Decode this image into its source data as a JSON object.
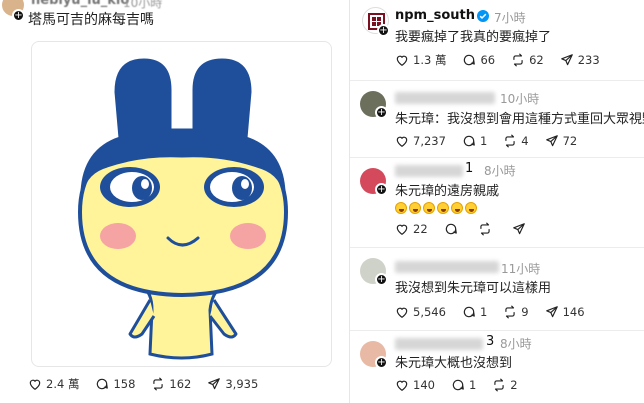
{
  "left_post": {
    "author": "hebiyu_lu_kio",
    "time": "10小時",
    "caption": "塔馬可吉的麻每吉嗎",
    "actions": {
      "likes": "2.4 萬",
      "comments": "158",
      "reposts": "162",
      "shares": "3,935"
    }
  },
  "right_post": {
    "author": "npm_south",
    "time": "7小時",
    "text": "我要瘋掉了我真的要瘋掉了",
    "actions": {
      "likes": "1.3 萬",
      "comments": "66",
      "reposts": "62",
      "shares": "233"
    }
  },
  "replies": [
    {
      "time": "10小時",
      "text": "朱元璋：我沒想到會用這種方式重回大眾視野",
      "actions": {
        "likes": "7,237",
        "comments": "1",
        "reposts": "4",
        "shares": "72"
      }
    },
    {
      "time": "8小時",
      "name_suffix": "1",
      "text": "朱元璋的遠房親戚",
      "emoji_count": 6,
      "actions": {
        "likes": "22"
      }
    },
    {
      "time": "11小時",
      "text": "我沒想到朱元璋可以這樣用",
      "actions": {
        "likes": "5,546",
        "comments": "1",
        "reposts": "9",
        "shares": "146"
      }
    },
    {
      "time": "8小時",
      "name_suffix": "3",
      "text": "朱元璋大概也沒想到",
      "actions": {
        "likes": "140",
        "comments": "1",
        "reposts": "2"
      }
    }
  ],
  "icons": {
    "like": "heart-icon",
    "comment": "comment-icon",
    "repost": "repost-icon",
    "share": "send-icon",
    "verified": "verified-badge-icon"
  },
  "colors": {
    "verified": "#0095f6",
    "mascot_blue": "#1f4f9a",
    "mascot_yellow": "#fff49a",
    "cheek": "#f5a3a3"
  }
}
